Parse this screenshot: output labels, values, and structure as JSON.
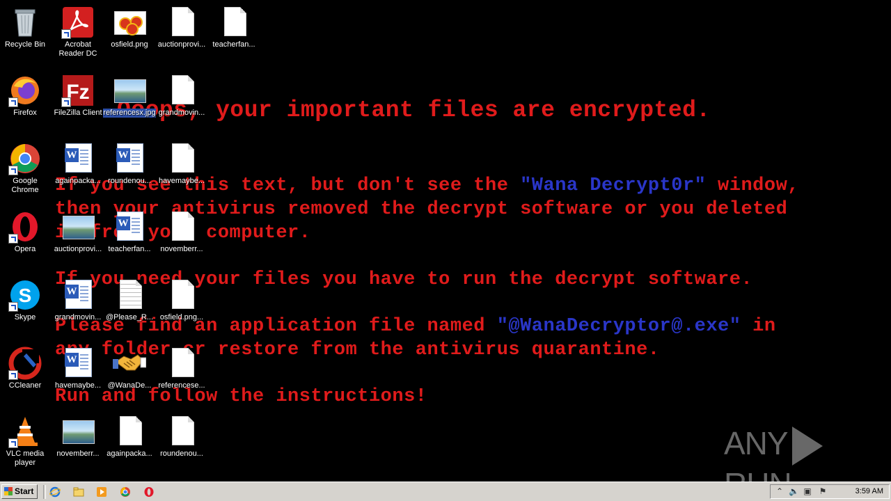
{
  "wallpaper": {
    "title": "Ooops, your important files are encrypted.",
    "p1_a": "If you see this text, but don't see the ",
    "p1_b": "\"Wana Decrypt0r\"",
    "p1_c": " window,",
    "p1_line2": "then your antivirus removed the decrypt software or you deleted",
    "p1_line3": "it from your computer.",
    "p2": "If you need your files you have to run the decrypt software.",
    "p3_a": "Please find an application file named ",
    "p3_b": "\"@WanaDecryptor@.exe\"",
    "p3_c": " in",
    "p3_line2": "any folder or restore from the antivirus quarantine.",
    "p4": "Run and follow the instructions!"
  },
  "icons": {
    "col1": [
      "Recycle Bin",
      "Acrobat Reader DC",
      "osfield.png",
      "auctionprovi...",
      "teacherfan..."
    ],
    "col2": [
      "Firefox",
      "FileZilla Client",
      "referencesx.jpg",
      "grandmovin..."
    ],
    "col3": [
      "Google Chrome",
      "againpacka...",
      "roundenou...",
      "havemaybe..."
    ],
    "col4": [
      "Opera",
      "auctionprovi...",
      "teacherfan...",
      "novemberr..."
    ],
    "col5": [
      "Skype",
      "grandmovin...",
      "@Please_R...",
      "osfield.png..."
    ],
    "col6": [
      "CCleaner",
      "havemaybe...",
      "@WanaDe...",
      "referencese..."
    ],
    "col7": [
      "VLC media player",
      "novemberr...",
      "againpacka...",
      "roundenou..."
    ]
  },
  "taskbar": {
    "start_label": "Start",
    "clock": "3:59 AM"
  },
  "watermark": {
    "left": "ANY",
    "right": "RUN"
  },
  "colors": {
    "wallpaper_text": "#e01b1b",
    "wallpaper_highlight": "#2a36c8",
    "taskbar": "#d6d3ce"
  }
}
